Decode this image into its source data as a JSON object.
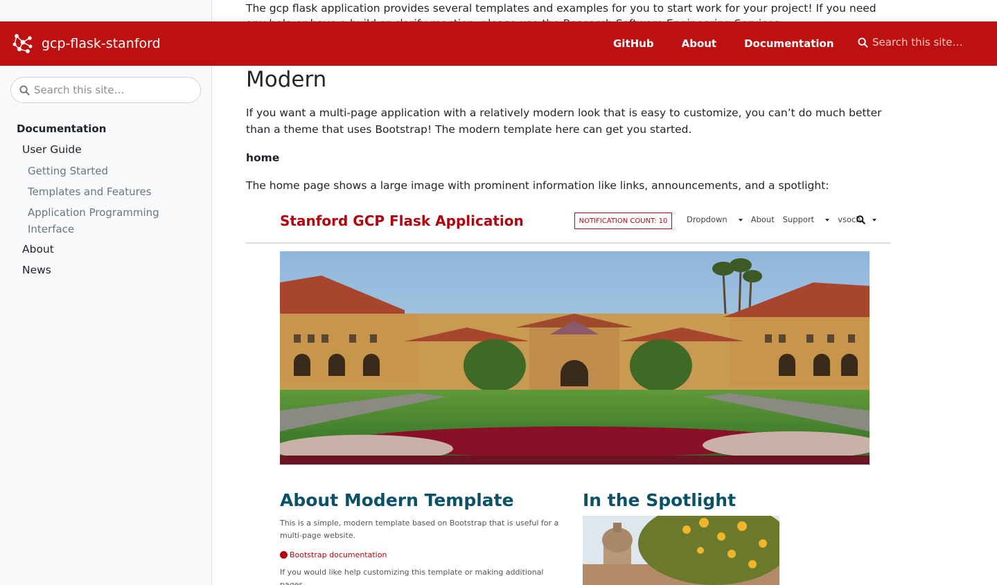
{
  "top_text": "The gcp flask application provides several templates and examples for you to start work for your project! If you need any help or have a build or clarify reaction, please use the Research Software Engineering Services.",
  "navbar": {
    "brand": "gcp-flask-stanford",
    "links": [
      "GitHub",
      "About",
      "Documentation"
    ],
    "search_placeholder": "Search this site…",
    "background": "#bd1111"
  },
  "sidebar": {
    "search_placeholder": "Search this site…",
    "section": "Documentation",
    "items": [
      {
        "label": "User Guide",
        "level": 1
      },
      {
        "label": "Getting Started",
        "level": 2
      },
      {
        "label": "Templates and Features",
        "level": 2
      },
      {
        "label": "Application Programming Interface",
        "level": 2
      },
      {
        "label": "About",
        "level": 1
      },
      {
        "label": "News",
        "level": 1
      }
    ]
  },
  "main": {
    "title": "Modern",
    "intro": "If you want a multi-page application with a relatively modern look that is easy to customize, you can’t do much better than a theme that uses Bootstrap! The modern template here can get you started.",
    "subheading": "home",
    "home_text": "The home page shows a large image with prominent information like links, announcements, and a spotlight:"
  },
  "screenshot": {
    "title": "Stanford GCP Flask Application",
    "badge": "NOTIFICATION COUNT: 10",
    "menu": [
      "Dropdown",
      "About",
      "Support",
      "vsoch"
    ],
    "about_heading": "About Modern Template",
    "about_text": "This is a simple, modern template based on Bootstrap that is useful for a multi-page website.",
    "about_link": "Bootstrap documentation",
    "about_more": "If you would like help customizing this template or making additional pages,",
    "spotlight_heading": "In the Spotlight",
    "accent": "#b1040e",
    "heading_color": "#0a5168"
  }
}
